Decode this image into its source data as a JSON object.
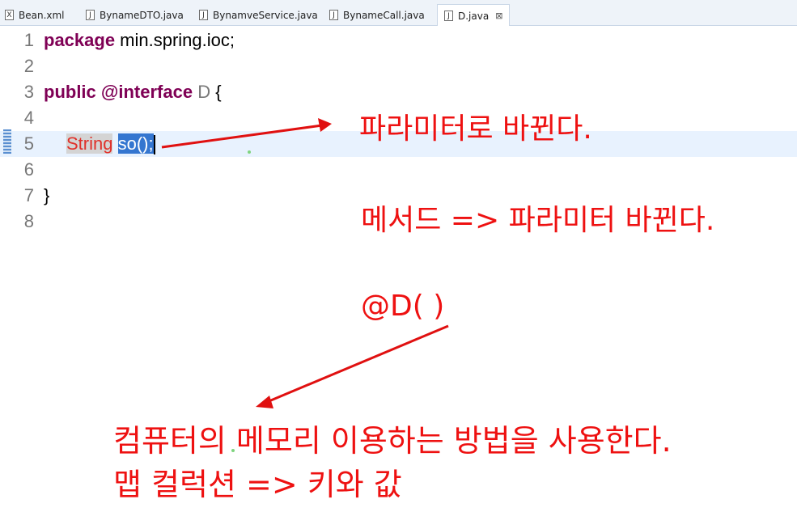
{
  "tabs": [
    {
      "label": "Bean.xml",
      "icon": "X"
    },
    {
      "label": "BynameDTO.java",
      "icon": "J"
    },
    {
      "label": "BynamveService.java",
      "icon": "J"
    },
    {
      "label": "BynameCall.java",
      "icon": "J"
    },
    {
      "label": "D.java",
      "icon": "J",
      "close": "⊠"
    }
  ],
  "editor": {
    "line_numbers": [
      "1",
      "2",
      "3",
      "4",
      "5",
      "6",
      "7",
      "8"
    ],
    "line1": {
      "kw": "package",
      "rest": " min.spring.ioc;"
    },
    "line3": {
      "kw1": "public",
      "kw2": "@interface",
      "name": " D",
      "brace": " {"
    },
    "line5": {
      "type": "String",
      "sel": "so();"
    },
    "line7": {
      "brace": "}"
    }
  },
  "annotations": {
    "note1": "파라미터로 바뀐다.",
    "note2": "메서드 => 파라미터 바뀐다.",
    "note3": "@D(    )",
    "note4": "컴퓨터의 메모리 이용하는 방법을 사용한다.",
    "note5": "맵 컬럭션 => 키와 값"
  },
  "colors": {
    "keyword": "#7f0055",
    "annotation": "#ee1111",
    "selection": "#3476d0"
  }
}
